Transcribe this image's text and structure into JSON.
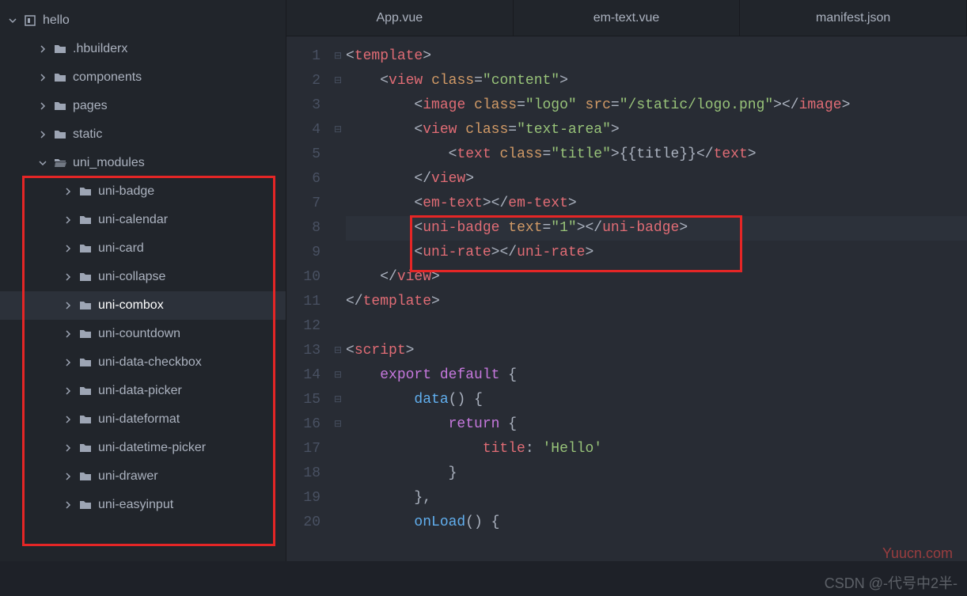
{
  "sidebar": {
    "root": {
      "name": "hello",
      "expanded": true
    },
    "items": [
      {
        "label": ".hbuilderx",
        "depth": 1,
        "expanded": false,
        "type": "folder"
      },
      {
        "label": "components",
        "depth": 1,
        "expanded": false,
        "type": "folder"
      },
      {
        "label": "pages",
        "depth": 1,
        "expanded": false,
        "type": "folder"
      },
      {
        "label": "static",
        "depth": 1,
        "expanded": false,
        "type": "folder"
      },
      {
        "label": "uni_modules",
        "depth": 1,
        "expanded": true,
        "type": "folder"
      },
      {
        "label": "uni-badge",
        "depth": 2,
        "expanded": false,
        "type": "folder"
      },
      {
        "label": "uni-calendar",
        "depth": 2,
        "expanded": false,
        "type": "folder"
      },
      {
        "label": "uni-card",
        "depth": 2,
        "expanded": false,
        "type": "folder"
      },
      {
        "label": "uni-collapse",
        "depth": 2,
        "expanded": false,
        "type": "folder"
      },
      {
        "label": "uni-combox",
        "depth": 2,
        "expanded": false,
        "type": "folder",
        "selected": true
      },
      {
        "label": "uni-countdown",
        "depth": 2,
        "expanded": false,
        "type": "folder"
      },
      {
        "label": "uni-data-checkbox",
        "depth": 2,
        "expanded": false,
        "type": "folder"
      },
      {
        "label": "uni-data-picker",
        "depth": 2,
        "expanded": false,
        "type": "folder"
      },
      {
        "label": "uni-dateformat",
        "depth": 2,
        "expanded": false,
        "type": "folder"
      },
      {
        "label": "uni-datetime-picker",
        "depth": 2,
        "expanded": false,
        "type": "folder"
      },
      {
        "label": "uni-drawer",
        "depth": 2,
        "expanded": false,
        "type": "folder"
      },
      {
        "label": "uni-easyinput",
        "depth": 2,
        "expanded": false,
        "type": "folder"
      }
    ]
  },
  "tabs": [
    {
      "label": "App.vue"
    },
    {
      "label": "em-text.vue"
    },
    {
      "label": "manifest.json"
    }
  ],
  "code": {
    "lines": [
      {
        "n": 1,
        "fold": "minus",
        "tokens": [
          [
            "c-punct",
            "<"
          ],
          [
            "c-tag",
            "template"
          ],
          [
            "c-punct",
            ">"
          ]
        ]
      },
      {
        "n": 2,
        "fold": "minus",
        "tokens": [
          [
            "c-plain",
            "    "
          ],
          [
            "c-punct",
            "<"
          ],
          [
            "c-tag",
            "view"
          ],
          [
            "c-plain",
            " "
          ],
          [
            "c-attr",
            "class"
          ],
          [
            "c-punct",
            "="
          ],
          [
            "c-str",
            "\"content\""
          ],
          [
            "c-punct",
            ">"
          ]
        ]
      },
      {
        "n": 3,
        "fold": "",
        "tokens": [
          [
            "c-plain",
            "        "
          ],
          [
            "c-punct",
            "<"
          ],
          [
            "c-tag",
            "image"
          ],
          [
            "c-plain",
            " "
          ],
          [
            "c-attr",
            "class"
          ],
          [
            "c-punct",
            "="
          ],
          [
            "c-str",
            "\"logo\""
          ],
          [
            "c-plain",
            " "
          ],
          [
            "c-attr",
            "src"
          ],
          [
            "c-punct",
            "="
          ],
          [
            "c-str",
            "\"/static/logo.png\""
          ],
          [
            "c-punct",
            "></"
          ],
          [
            "c-tag",
            "image"
          ],
          [
            "c-punct",
            ">"
          ]
        ]
      },
      {
        "n": 4,
        "fold": "minus",
        "tokens": [
          [
            "c-plain",
            "        "
          ],
          [
            "c-punct",
            "<"
          ],
          [
            "c-tag",
            "view"
          ],
          [
            "c-plain",
            " "
          ],
          [
            "c-attr",
            "class"
          ],
          [
            "c-punct",
            "="
          ],
          [
            "c-str",
            "\"text-area\""
          ],
          [
            "c-punct",
            ">"
          ]
        ]
      },
      {
        "n": 5,
        "fold": "",
        "tokens": [
          [
            "c-plain",
            "            "
          ],
          [
            "c-punct",
            "<"
          ],
          [
            "c-tag",
            "text"
          ],
          [
            "c-plain",
            " "
          ],
          [
            "c-attr",
            "class"
          ],
          [
            "c-punct",
            "="
          ],
          [
            "c-str",
            "\"title\""
          ],
          [
            "c-punct",
            ">"
          ],
          [
            "c-plain",
            "{{title}}"
          ],
          [
            "c-punct",
            "</"
          ],
          [
            "c-tag",
            "text"
          ],
          [
            "c-punct",
            ">"
          ]
        ]
      },
      {
        "n": 6,
        "fold": "",
        "tokens": [
          [
            "c-plain",
            "        "
          ],
          [
            "c-punct",
            "</"
          ],
          [
            "c-tag",
            "view"
          ],
          [
            "c-punct",
            ">"
          ]
        ]
      },
      {
        "n": 7,
        "fold": "",
        "tokens": [
          [
            "c-plain",
            "        "
          ],
          [
            "c-punct",
            "<"
          ],
          [
            "c-tag",
            "em-text"
          ],
          [
            "c-punct",
            "></"
          ],
          [
            "c-tag",
            "em-text"
          ],
          [
            "c-punct",
            ">"
          ]
        ]
      },
      {
        "n": 8,
        "fold": "",
        "hl": true,
        "tokens": [
          [
            "c-plain",
            "        "
          ],
          [
            "c-punct",
            "<"
          ],
          [
            "c-tag",
            "uni-badge"
          ],
          [
            "c-plain",
            " "
          ],
          [
            "c-attr",
            "text"
          ],
          [
            "c-punct",
            "="
          ],
          [
            "c-str",
            "\"1\""
          ],
          [
            "c-punct",
            "></"
          ],
          [
            "c-tag",
            "uni-badge"
          ],
          [
            "c-punct",
            ">"
          ]
        ]
      },
      {
        "n": 9,
        "fold": "",
        "tokens": [
          [
            "c-plain",
            "        "
          ],
          [
            "c-punct",
            "<"
          ],
          [
            "c-tag",
            "uni-rate"
          ],
          [
            "c-punct",
            "></"
          ],
          [
            "c-tag",
            "uni-rate"
          ],
          [
            "c-punct",
            ">"
          ]
        ]
      },
      {
        "n": 10,
        "fold": "",
        "tokens": [
          [
            "c-plain",
            "    "
          ],
          [
            "c-punct",
            "</"
          ],
          [
            "c-tag",
            "view"
          ],
          [
            "c-punct",
            ">"
          ]
        ]
      },
      {
        "n": 11,
        "fold": "",
        "tokens": [
          [
            "c-punct",
            "</"
          ],
          [
            "c-tag",
            "template"
          ],
          [
            "c-punct",
            ">"
          ]
        ]
      },
      {
        "n": 12,
        "fold": "",
        "tokens": []
      },
      {
        "n": 13,
        "fold": "minus",
        "tokens": [
          [
            "c-punct",
            "<"
          ],
          [
            "c-tag",
            "script"
          ],
          [
            "c-punct",
            ">"
          ]
        ]
      },
      {
        "n": 14,
        "fold": "minus",
        "tokens": [
          [
            "c-plain",
            "    "
          ],
          [
            "c-kw",
            "export"
          ],
          [
            "c-plain",
            " "
          ],
          [
            "c-kw",
            "default"
          ],
          [
            "c-plain",
            " "
          ],
          [
            "c-punct",
            "{"
          ]
        ]
      },
      {
        "n": 15,
        "fold": "minus",
        "tokens": [
          [
            "c-plain",
            "        "
          ],
          [
            "c-fn",
            "data"
          ],
          [
            "c-punct",
            "()"
          ],
          [
            "c-plain",
            " "
          ],
          [
            "c-punct",
            "{"
          ]
        ]
      },
      {
        "n": 16,
        "fold": "minus",
        "tokens": [
          [
            "c-plain",
            "            "
          ],
          [
            "c-kw",
            "return"
          ],
          [
            "c-plain",
            " "
          ],
          [
            "c-punct",
            "{"
          ]
        ]
      },
      {
        "n": 17,
        "fold": "",
        "tokens": [
          [
            "c-plain",
            "                "
          ],
          [
            "c-prop",
            "title"
          ],
          [
            "c-punct",
            ":"
          ],
          [
            "c-plain",
            " "
          ],
          [
            "c-str",
            "'Hello'"
          ]
        ]
      },
      {
        "n": 18,
        "fold": "",
        "tokens": [
          [
            "c-plain",
            "            "
          ],
          [
            "c-punct",
            "}"
          ]
        ]
      },
      {
        "n": 19,
        "fold": "",
        "tokens": [
          [
            "c-plain",
            "        "
          ],
          [
            "c-punct",
            "},"
          ]
        ]
      },
      {
        "n": 20,
        "fold": "",
        "tokens": [
          [
            "c-plain",
            "        "
          ],
          [
            "c-fn",
            "onLoad"
          ],
          [
            "c-punct",
            "()"
          ],
          [
            "c-plain",
            " "
          ],
          [
            "c-punct",
            "{"
          ]
        ]
      }
    ]
  },
  "watermarks": {
    "w1": "Yuucn.com",
    "w2": "CSDN @-代号中2半-"
  }
}
